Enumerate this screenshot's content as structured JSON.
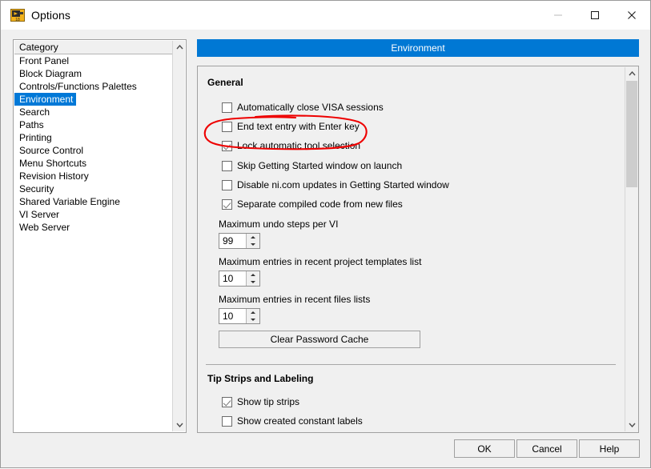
{
  "window": {
    "title": "Options",
    "icon": "labview-options-icon",
    "controls": {
      "minimize": "minimize-icon",
      "maximize": "maximize-icon",
      "close": "close-icon"
    }
  },
  "category_list": {
    "header": "Category",
    "selected": "Environment",
    "items": [
      "Front Panel",
      "Block Diagram",
      "Controls/Functions Palettes",
      "Environment",
      "Search",
      "Paths",
      "Printing",
      "Source Control",
      "Menu Shortcuts",
      "Revision History",
      "Security",
      "Shared Variable Engine",
      "VI Server",
      "Web Server"
    ]
  },
  "panel": {
    "banner_title": "Environment",
    "banner_color": "#0078d4",
    "highlight_color": "#0078d7",
    "sections": [
      {
        "title": "General",
        "checkboxes": [
          {
            "label": "Automatically close VISA sessions",
            "checked": false
          },
          {
            "label": "End text entry with Enter key",
            "checked": false
          },
          {
            "label": "Lock automatic tool selection",
            "checked": true
          },
          {
            "label": "Skip Getting Started window on launch",
            "checked": false
          },
          {
            "label": "Disable ni.com updates in Getting Started window",
            "checked": false
          },
          {
            "label": "Separate compiled code from new files",
            "checked": true
          }
        ],
        "numeric_fields": [
          {
            "label": "Maximum undo steps per VI",
            "value": "99"
          },
          {
            "label": "Maximum entries in recent project templates list",
            "value": "10"
          },
          {
            "label": "Maximum entries in recent files lists",
            "value": "10"
          }
        ],
        "button": "Clear Password Cache"
      },
      {
        "title": "Tip Strips and Labeling",
        "checkboxes": [
          {
            "label": "Show tip strips",
            "checked": true
          },
          {
            "label": "Show created constant labels",
            "checked": false
          }
        ]
      }
    ]
  },
  "footer": {
    "ok": "OK",
    "cancel": "Cancel",
    "help": "Help"
  },
  "annotation": {
    "type": "hand-drawn-ellipse",
    "color": "#ee0000",
    "targets": "End text entry with Enter key"
  }
}
